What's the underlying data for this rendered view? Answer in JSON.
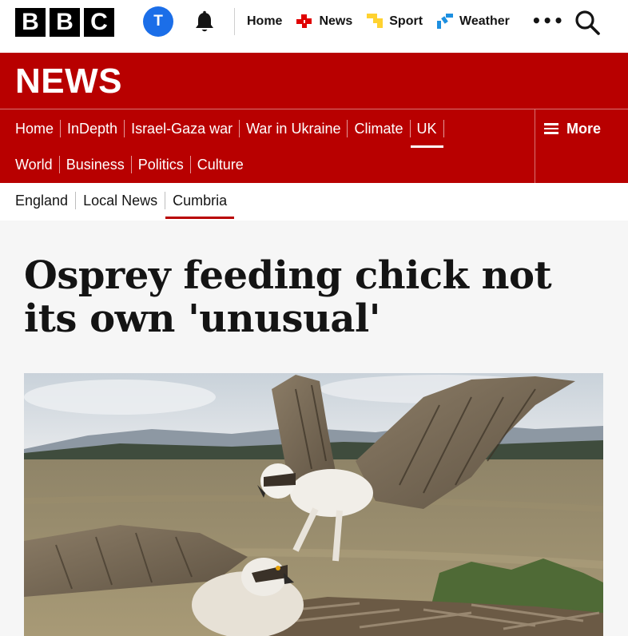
{
  "masthead": {
    "logo_letters": [
      "B",
      "B",
      "C"
    ],
    "avatar_initial": "T",
    "nav": [
      {
        "label": "Home",
        "icon": "none"
      },
      {
        "label": "News",
        "icon": "news-icon",
        "color": "#e00000"
      },
      {
        "label": "Sport",
        "icon": "sport-icon",
        "color": "#ffd230"
      },
      {
        "label": "Weather",
        "icon": "weather-icon",
        "color": "#1d8fe0"
      }
    ],
    "more_dots": "•••"
  },
  "section": {
    "title": "NEWS",
    "primary_nav": [
      "Home",
      "InDepth",
      "Israel-Gaza war",
      "War in Ukraine",
      "Climate",
      "UK",
      "World",
      "Business",
      "Politics",
      "Culture"
    ],
    "active_primary": "UK",
    "more_label": "More",
    "secondary_nav": [
      "England",
      "Local News",
      "Cumbria"
    ],
    "active_secondary": "Cumbria"
  },
  "article": {
    "headline": "Osprey feeding chick not its own 'unusual'"
  },
  "colors": {
    "brand_red": "#b80000",
    "avatar_blue": "#1b6ee8",
    "article_bg": "#f6f6f6"
  }
}
